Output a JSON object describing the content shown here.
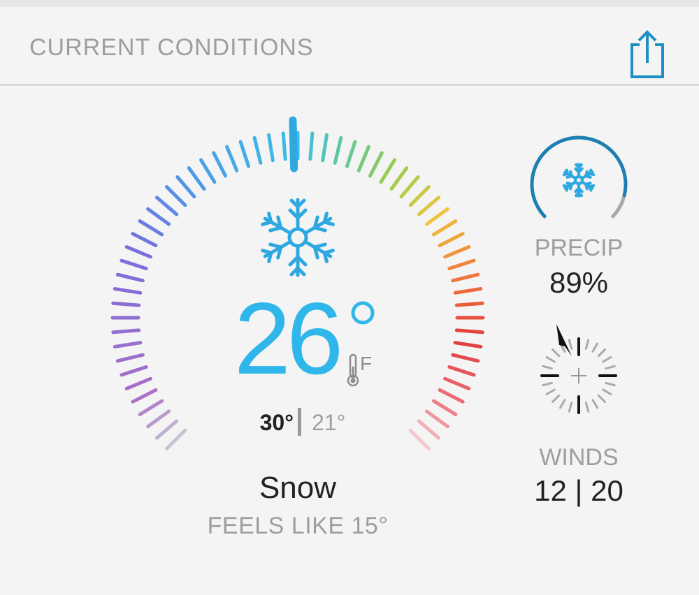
{
  "header": {
    "title": "CURRENT CONDITIONS",
    "share_icon": "share-icon"
  },
  "current": {
    "temperature": "26",
    "degree_symbol": "°",
    "unit": "F",
    "high": "30°",
    "low": "21°",
    "condition": "Snow",
    "feels_like": "FEELS LIKE 15°",
    "condition_icon": "snowflake-icon",
    "gauge_level": 0.5
  },
  "precip": {
    "label": "PRECIP",
    "value": "89%",
    "percent": 89,
    "icon": "snowflake-icon"
  },
  "winds": {
    "label": "WINDS",
    "value": "12 | 20",
    "icon": "wind-compass-icon"
  },
  "colors": {
    "accent": "#2fb6ea",
    "precip_ring": "#1f7fb0",
    "muted": "#9e9e9e"
  }
}
